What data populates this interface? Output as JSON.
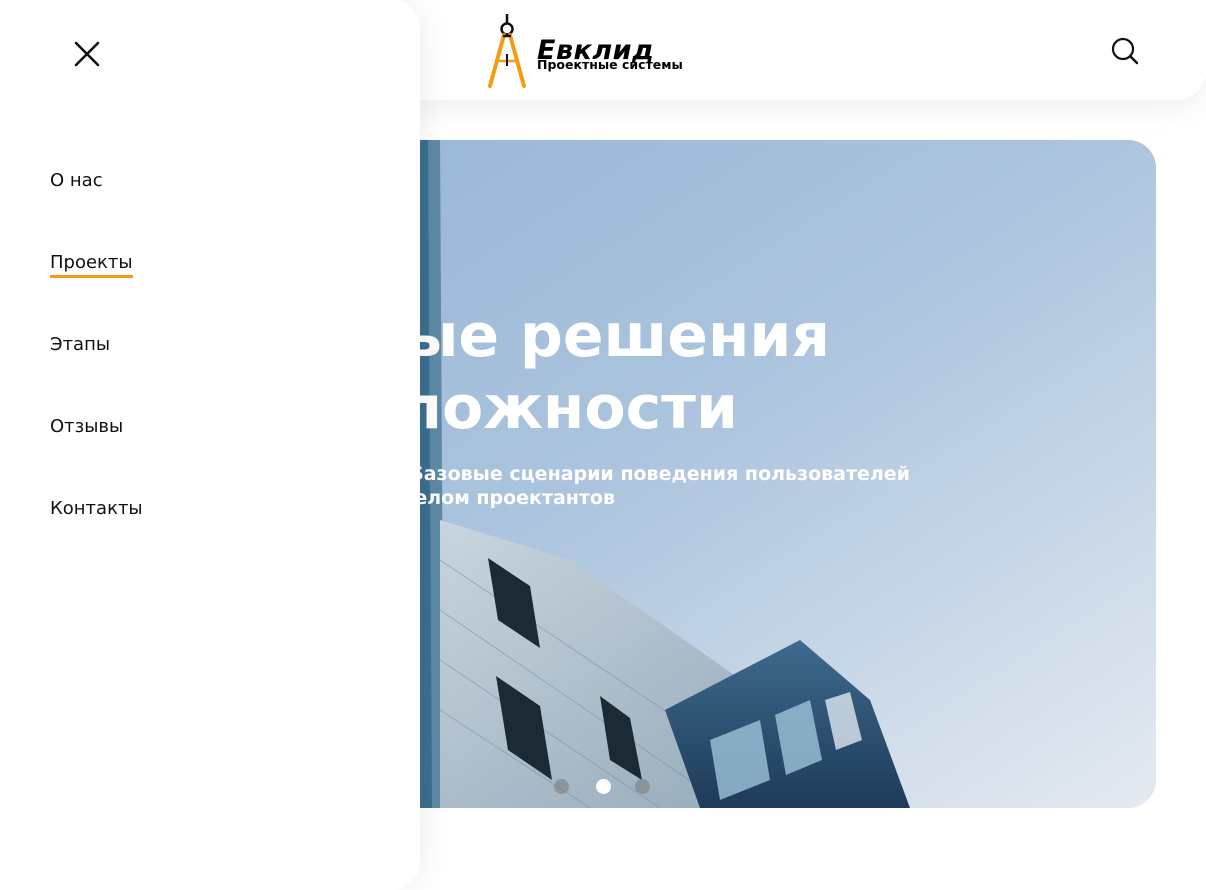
{
  "brand": {
    "name": "Евклид",
    "tagline": "Проектные системы",
    "accent_color": "#f39c12"
  },
  "header": {
    "search_icon": "search-icon"
  },
  "menu": {
    "close_icon": "close-icon",
    "items": [
      {
        "label": "О нас",
        "active": false
      },
      {
        "label": "Проекты",
        "active": true
      },
      {
        "label": "Этапы",
        "active": false
      },
      {
        "label": "Отзывы",
        "active": false
      },
      {
        "label": "Контакты",
        "active": false
      }
    ]
  },
  "hero": {
    "title_line1": "ые решения",
    "title_line2": "ложности",
    "subtitle_line1": "Базовые сценарии поведения пользователей",
    "subtitle_line2": "елом проектантов",
    "slides_total": 3,
    "active_slide": 2
  }
}
